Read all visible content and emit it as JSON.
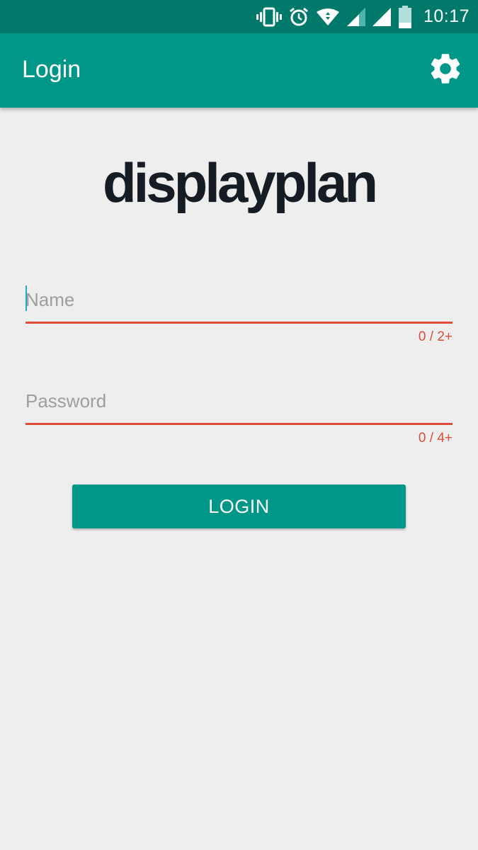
{
  "status_bar": {
    "time": "10:17",
    "icons": [
      "vibrate-icon",
      "alarm-icon",
      "wifi-icon",
      "signal-icon",
      "signal-icon",
      "battery-icon"
    ]
  },
  "app_bar": {
    "title": "Login",
    "settings_icon": "gear-icon",
    "background_color": "#009688"
  },
  "logo": {
    "text": "displayplan"
  },
  "form": {
    "name": {
      "placeholder": "Name",
      "value": "",
      "counter": "0 / 2+"
    },
    "password": {
      "placeholder": "Password",
      "value": "",
      "counter": "0 / 4+"
    },
    "error_color": "#de4b39"
  },
  "login_button": {
    "label": "LOGIN"
  }
}
